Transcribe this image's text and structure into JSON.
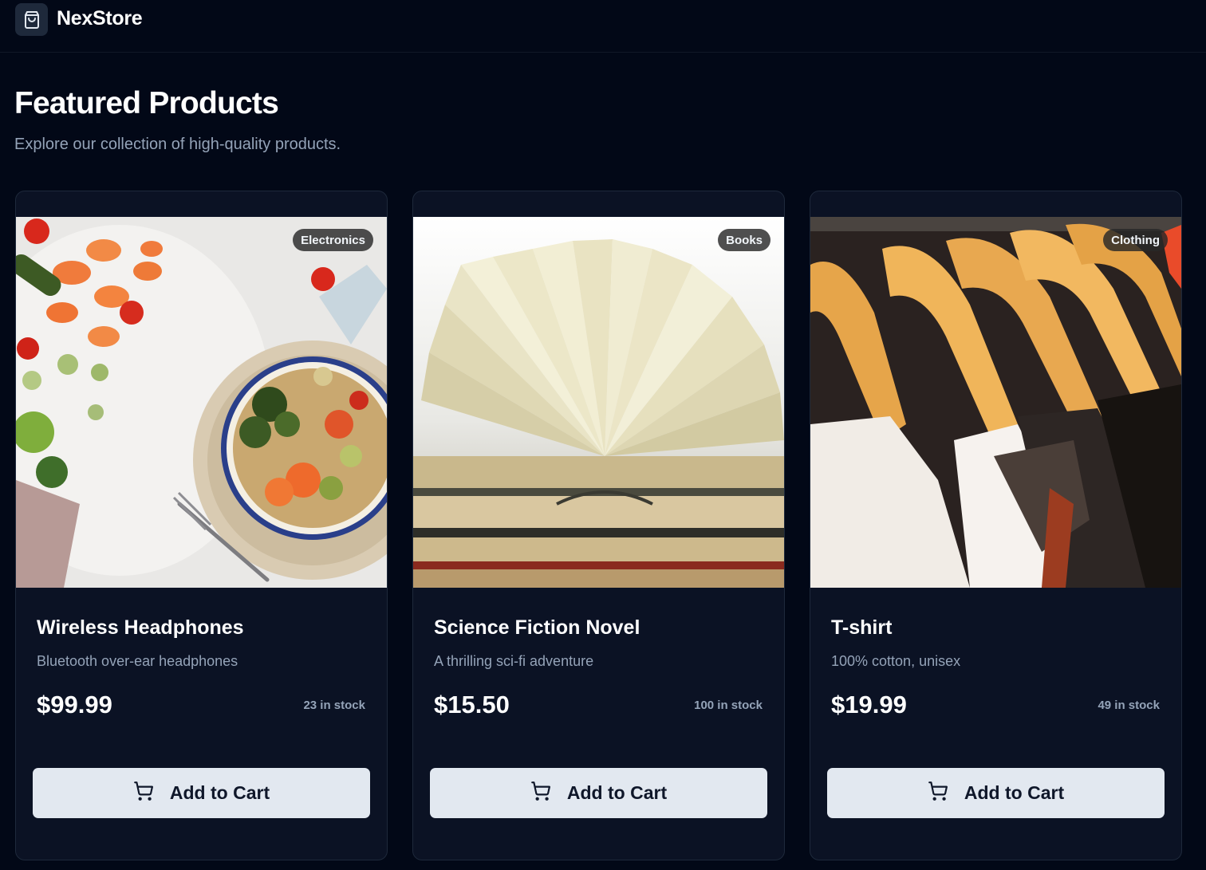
{
  "header": {
    "brand": "NexStore",
    "logo_icon": "shopping-bag-icon"
  },
  "main": {
    "title": "Featured Products",
    "subtitle": "Explore our collection of high-quality products."
  },
  "products": [
    {
      "name": "Wireless Headphones",
      "description": "Bluetooth over-ear headphones",
      "price": "$99.99",
      "stock": "23 in stock",
      "category": "Electronics",
      "button_label": "Add to Cart",
      "button_icon": "shopping-cart-icon"
    },
    {
      "name": "Science Fiction Novel",
      "description": "A thrilling sci-fi adventure",
      "price": "$15.50",
      "stock": "100 in stock",
      "category": "Books",
      "button_label": "Add to Cart",
      "button_icon": "shopping-cart-icon"
    },
    {
      "name": "T-shirt",
      "description": "100% cotton, unisex",
      "price": "$19.99",
      "stock": "49 in stock",
      "category": "Clothing",
      "button_label": "Add to Cart",
      "button_icon": "shopping-cart-icon"
    }
  ],
  "colors": {
    "background": "#020817",
    "card": "#0b1224",
    "button": "#e2e8f0",
    "muted_text": "#94a3b8"
  }
}
